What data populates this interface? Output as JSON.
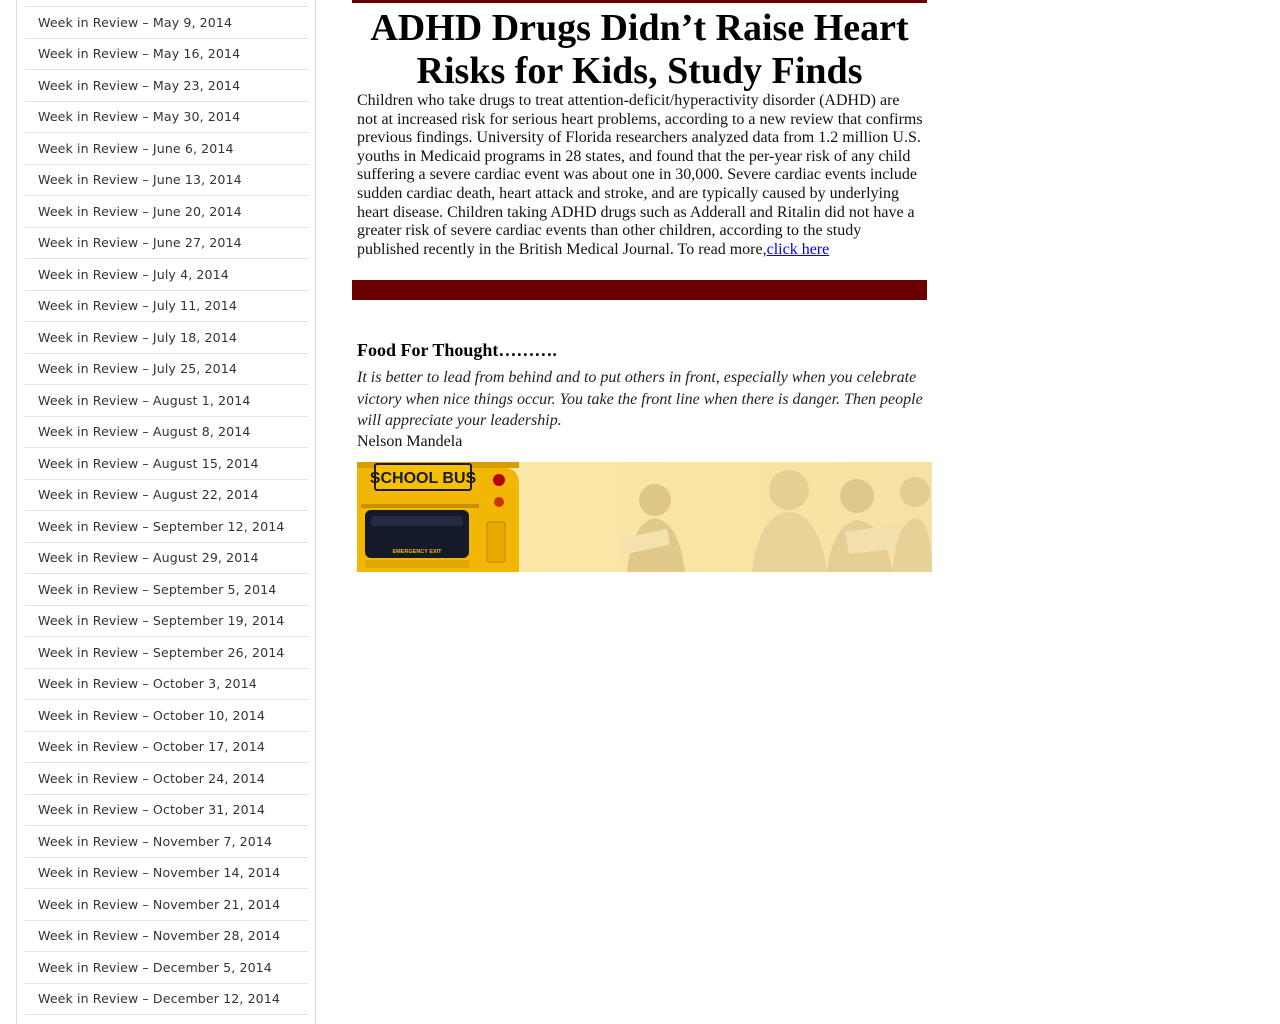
{
  "sidebar": {
    "items": [
      {
        "label": "Week in Review – May 9, 2014"
      },
      {
        "label": "Week in Review – May 16, 2014"
      },
      {
        "label": "Week in Review – May 23, 2014"
      },
      {
        "label": "Week in Review – May 30, 2014"
      },
      {
        "label": "Week in Review – June 6, 2014"
      },
      {
        "label": "Week in Review – June 13, 2014"
      },
      {
        "label": "Week in Review – June 20, 2014"
      },
      {
        "label": "Week in Review – June 27, 2014"
      },
      {
        "label": "Week in Review – July 4, 2014"
      },
      {
        "label": "Week in Review – July 11, 2014"
      },
      {
        "label": "Week in Review – July 18, 2014"
      },
      {
        "label": "Week in Review – July 25, 2014"
      },
      {
        "label": "Week in Review – August 1, 2014"
      },
      {
        "label": "Week in Review – August 8, 2014"
      },
      {
        "label": "Week in Review – August 15, 2014"
      },
      {
        "label": "Week in Review – August 22, 2014"
      },
      {
        "label": "Week in Review – September 12, 2014"
      },
      {
        "label": "Week in Review – August 29, 2014"
      },
      {
        "label": "Week in Review – September 5, 2014"
      },
      {
        "label": "Week in Review – September 19, 2014"
      },
      {
        "label": "Week in Review – September 26, 2014"
      },
      {
        "label": "Week in Review – October 3, 2014"
      },
      {
        "label": "Week in Review – October 10, 2014"
      },
      {
        "label": "Week in Review – October 17, 2014"
      },
      {
        "label": "Week in Review – October 24, 2014"
      },
      {
        "label": "Week in Review – October 31, 2014"
      },
      {
        "label": "Week in Review – November 7, 2014"
      },
      {
        "label": "Week in Review – November 14, 2014"
      },
      {
        "label": "Week in Review – November 21, 2014"
      },
      {
        "label": "Week in Review – November 28, 2014"
      },
      {
        "label": "Week in Review – December 5, 2014"
      },
      {
        "label": "Week in Review – December 12, 2014"
      }
    ]
  },
  "article": {
    "headline": "ADHD Drugs Didn’t Raise Heart Risks for Kids, Study Finds",
    "body": "Children who take drugs to treat attention-deficit/hyperactivity disorder (ADHD) are not at increased risk for serious heart problems, according to a new review that confirms previous findings. University of Florida researchers analyzed data from 1.2 million U.S. youths in Medicaid programs in 28 states, and found that the per-year risk of any child suffering a severe cardiac event was about one in 30,000. Severe cardiac events include sudden cardiac death, heart attack and stroke, and are typically caused by underlying heart disease. Children taking ADHD drugs such as Adderall and Ritalin did not have a greater risk of severe cardiac events than other children, according to the study published recently in the British Medical Journal. To read more,",
    "link_label": "click here"
  },
  "food_for_thought": {
    "heading": "Food For Thought……….",
    "quote": "It is better to lead from behind and to put others in front, especially when you celebrate victory when nice things occur. You take the front line when there is danger. Then people will appreciate your leadership.",
    "author": "Nelson Mandela"
  },
  "banner": {
    "bus_sign": "SCHOOL BUS",
    "bus_door_label": "EMERGENCY    EXIT"
  },
  "colors": {
    "accent_bar": "#6b0000",
    "link": "#0000ee",
    "banner_bg": "#fbe7a6",
    "bus_yellow": "#f2b705"
  }
}
